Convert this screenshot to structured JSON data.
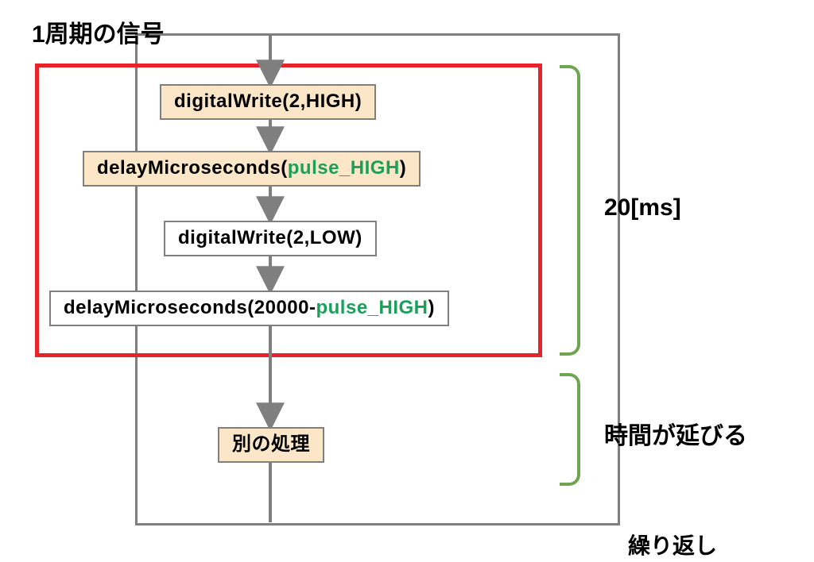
{
  "title": "1周期の信号",
  "steps": {
    "s1": {
      "pre": "digitalWrite(2,HIGH)"
    },
    "s2": {
      "pre": "delayMicroseconds(",
      "param": "pulse_HIGH",
      "post": ")"
    },
    "s3": {
      "pre": "digitalWrite(2,LOW)"
    },
    "s4": {
      "pre": "delayMicroseconds(20000- ",
      "param": "pulse_HIGH",
      "post": ")"
    },
    "s5": {
      "pre": "別の処理"
    }
  },
  "annotations": {
    "period": "20[ms]",
    "extend": "時間が延びる",
    "loop": "繰り返し"
  }
}
